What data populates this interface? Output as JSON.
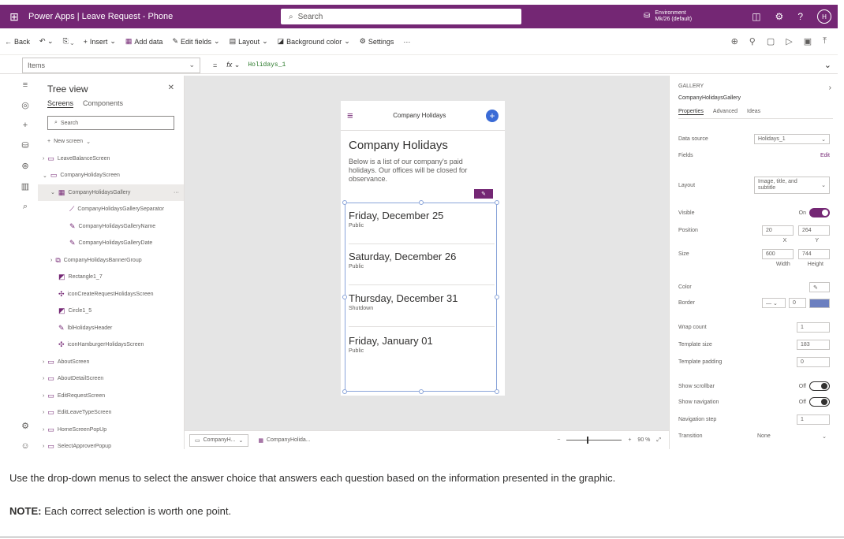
{
  "topbar": {
    "waffle": "⊞",
    "title": "Power Apps | Leave Request - Phone",
    "search_placeholder": "Search",
    "env_line1": "Environment",
    "env_line2": "Mk/26 (default)",
    "avatar": "H"
  },
  "cmdbar": {
    "back": "Back",
    "insert": "Insert",
    "add_data": "Add data",
    "edit_fields": "Edit fields",
    "layout": "Layout",
    "background_color": "Background color",
    "settings": "Settings",
    "more": "···"
  },
  "formula": {
    "property": "Items",
    "equals": "=",
    "fx": "fx",
    "value": "Holidays_1"
  },
  "tree": {
    "title": "Tree view",
    "tab_screens": "Screens",
    "tab_components": "Components",
    "search": "Search",
    "new_screen": "New screen",
    "nodes": [
      "LeaveBalanceScreen",
      "CompanyHolidayScreen",
      "CompanyHolidaysGallery",
      "CompanyHolidaysGallerySeparator",
      "CompanyHolidaysGalleryName",
      "CompanyHolidaysGalleryDate",
      "CompanyHolidaysBannerGroup",
      "Rectangle1_7",
      "iconCreateRequestHolidaysScreen",
      "Circle1_5",
      "lblHolidaysHeader",
      "iconHamburgerHolidaysScreen",
      "AboutScreen",
      "AboutDetailScreen",
      "EditRequestScreen",
      "EditLeaveTypeScreen",
      "HomeScreenPopUp",
      "SelectApproverPopup"
    ]
  },
  "phone": {
    "header": "Company Holidays",
    "heading": "Company Holidays",
    "description": "Below is a list of our company's paid holidays. Our offices will be closed for observance.",
    "items": [
      {
        "name": "Friday, December 25",
        "type": "Public"
      },
      {
        "name": "Saturday, December 26",
        "type": "Public"
      },
      {
        "name": "Thursday, December 31",
        "type": "Shutdown"
      },
      {
        "name": "Friday, January 01",
        "type": "Public"
      }
    ]
  },
  "bottombar": {
    "tab1": "CompanyH...",
    "tab2": "CompanyHolida...",
    "zoom": "90 %"
  },
  "props": {
    "type": "GALLERY",
    "name": "CompanyHolidaysGallery",
    "tab_properties": "Properties",
    "tab_advanced": "Advanced",
    "tab_ideas": "Ideas",
    "data_source_label": "Data source",
    "data_source": "Holidays_1",
    "fields_label": "Fields",
    "fields_edit": "Edit",
    "layout_label": "Layout",
    "layout": "Image, title, and subtitle",
    "visible_label": "Visible",
    "visible": "On",
    "position_label": "Position",
    "x": "20",
    "y": "264",
    "x_label": "X",
    "y_label": "Y",
    "size_label": "Size",
    "w": "600",
    "h": "744",
    "w_label": "Width",
    "h_label": "Height",
    "color_label": "Color",
    "border_label": "Border",
    "border_width": "0",
    "wrap_label": "Wrap count",
    "wrap": "1",
    "template_size_label": "Template size",
    "template_size": "183",
    "template_padding_label": "Template padding",
    "template_padding": "0",
    "scrollbar_label": "Show scrollbar",
    "scrollbar": "Off",
    "navigation_label": "Show navigation",
    "navigation": "Off",
    "nav_step_label": "Navigation step",
    "nav_step": "1",
    "transition_label": "Transition",
    "transition": "None"
  },
  "instructions": "Use the drop-down menus to select the answer choice that answers each question based on the information presented in the graphic.",
  "note_label": "NOTE:",
  "note_text": " Each correct selection is worth one point."
}
